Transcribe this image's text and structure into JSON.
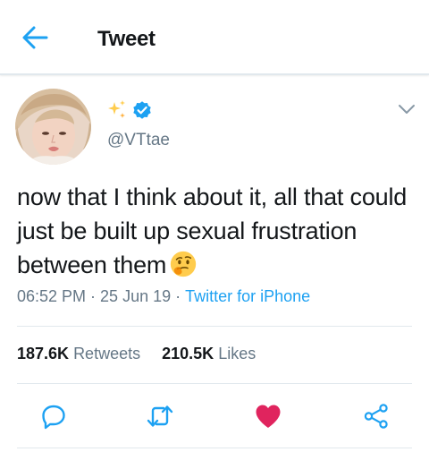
{
  "header": {
    "title": "Tweet",
    "back_icon": "arrow-left-icon"
  },
  "user": {
    "name_icons": [
      "sparkles-icon",
      "verified-badge-icon"
    ],
    "handle": "@VTtae",
    "avatar": "profile-photo"
  },
  "tweet": {
    "text": "now that I think about it, all that could just be built up sexual frustration between them",
    "emoji": "thinking-face-icon",
    "time": "06:52 PM",
    "date": "25 Jun 19",
    "source": "Twitter for iPhone",
    "separator": "·"
  },
  "stats": {
    "retweets_count": "187.6K",
    "retweets_label": "Retweets",
    "likes_count": "210.5K",
    "likes_label": "Likes"
  },
  "actions": [
    "reply-icon",
    "retweet-icon",
    "like-icon",
    "share-icon"
  ],
  "colors": {
    "accent": "#1da1f2",
    "like": "#e0245e",
    "text": "#14171a",
    "secondary": "#657786",
    "divider": "#e1e8ed"
  }
}
